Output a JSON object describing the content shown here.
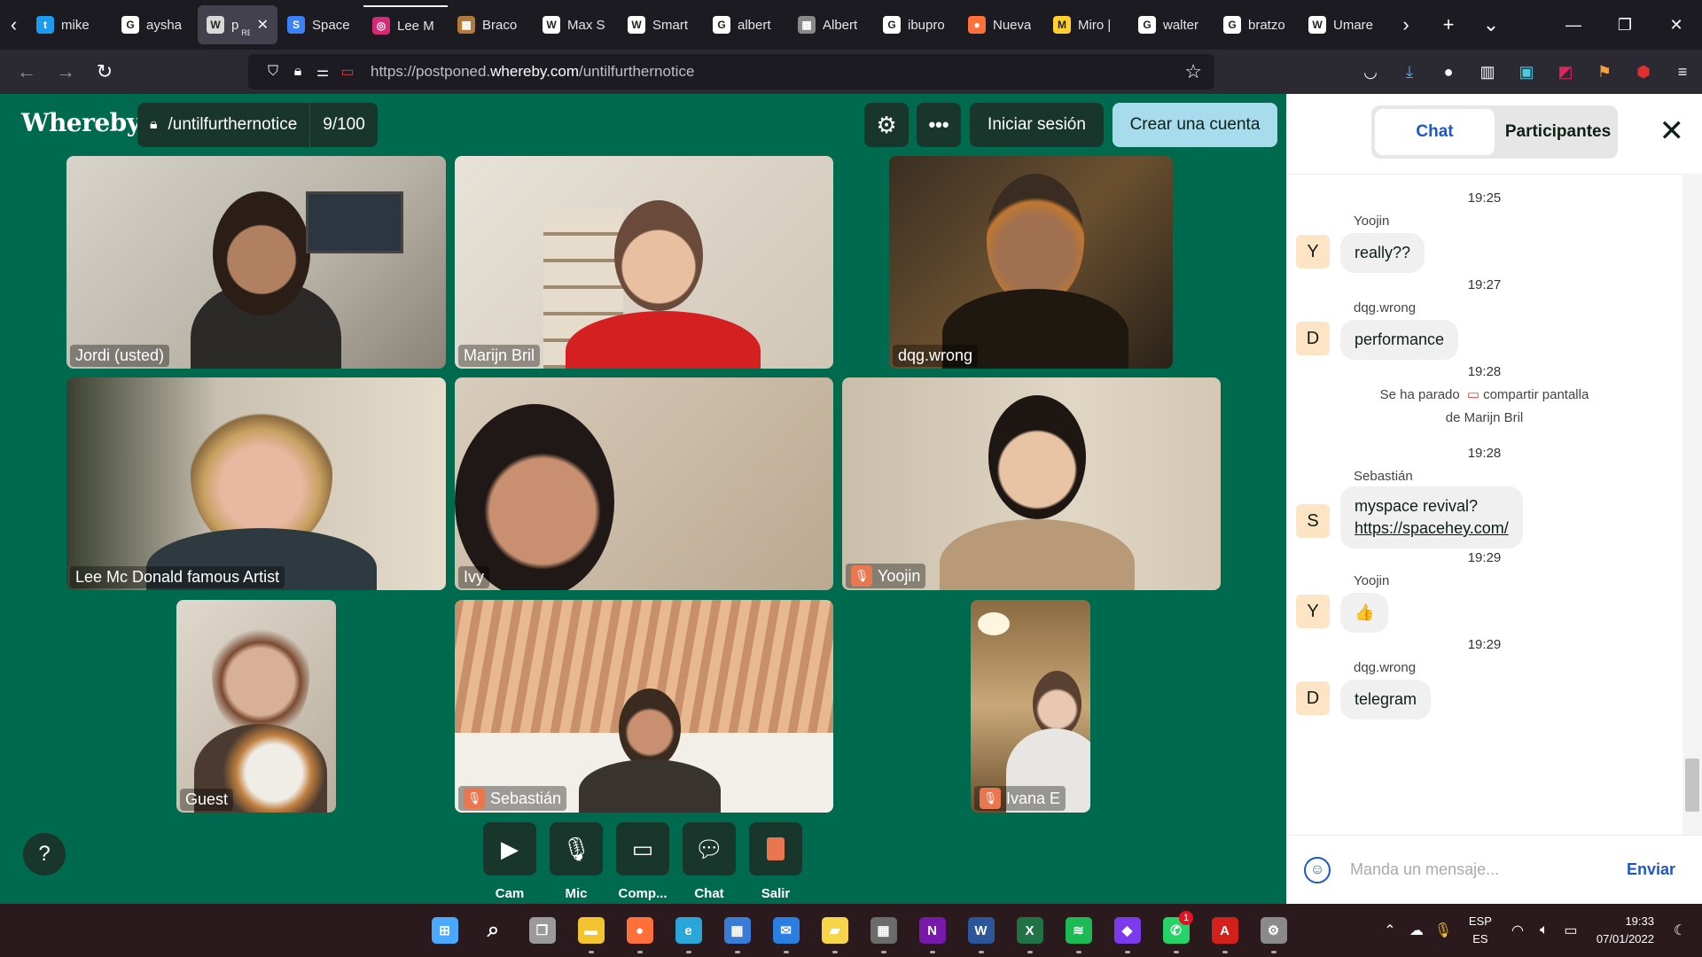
{
  "browser": {
    "tabs": [
      {
        "label": "mike",
        "favicon": "twitter-icon",
        "color": "#1d9bf0",
        "glyph": "t"
      },
      {
        "label": "aysha",
        "favicon": "google-icon",
        "color": "#ffffff",
        "glyph": "G"
      },
      {
        "label": "pos",
        "label2": "REPL",
        "favicon": "wikipedia-icon",
        "color": "#d8d8d8",
        "glyph": "W",
        "active": true
      },
      {
        "label": "Space",
        "favicon": "chat-icon",
        "color": "#3b82f6",
        "glyph": "S"
      },
      {
        "label": "Lee M",
        "favicon": "instagram-icon",
        "color": "#d62976",
        "glyph": "◎",
        "playing": true
      },
      {
        "label": "Braco",
        "favicon": "image-icon",
        "color": "#b07a3b",
        "glyph": "▦"
      },
      {
        "label": "Max S",
        "favicon": "wikipedia-icon",
        "color": "#ffffff",
        "glyph": "W"
      },
      {
        "label": "Smart",
        "favicon": "wikipedia-icon",
        "color": "#ffffff",
        "glyph": "W"
      },
      {
        "label": "albert",
        "favicon": "google-icon",
        "color": "#ffffff",
        "glyph": "G"
      },
      {
        "label": "Albert",
        "favicon": "image-icon",
        "color": "#888888",
        "glyph": "▦"
      },
      {
        "label": "ibupro",
        "favicon": "google-icon",
        "color": "#ffffff",
        "glyph": "G"
      },
      {
        "label": "Nueva",
        "favicon": "firefox-icon",
        "color": "#ff7139",
        "glyph": "●"
      },
      {
        "label": "Miro |",
        "favicon": "miro-icon",
        "color": "#ffd02f",
        "glyph": "M"
      },
      {
        "label": "walter",
        "favicon": "google-icon",
        "color": "#ffffff",
        "glyph": "G"
      },
      {
        "label": "bratzo",
        "favicon": "google-icon",
        "color": "#ffffff",
        "glyph": "G"
      },
      {
        "label": "Umare",
        "favicon": "wikipedia-icon",
        "color": "#ffffff",
        "glyph": "W"
      }
    ],
    "url_prefix": "https://postponed.",
    "url_domain": "whereby.com",
    "url_path": "/untilfurthernotice"
  },
  "app": {
    "logo": "Whereby",
    "room_name": "/untilfurthernotice",
    "participant_count": "9/100",
    "login_label": "Iniciar sesión",
    "signup_label": "Crear una cuenta",
    "help_label": "?",
    "accent": "#006a4e",
    "controls": [
      {
        "label": "Cam",
        "icon": "camera-icon"
      },
      {
        "label": "Mic",
        "icon": "microphone-icon"
      },
      {
        "label": "Comp...",
        "icon": "screen-share-icon"
      },
      {
        "label": "Chat",
        "icon": "chat-icon"
      },
      {
        "label": "Salir",
        "icon": "leave-icon"
      }
    ]
  },
  "participants": [
    {
      "name": "Jordi (usted)",
      "muted": false
    },
    {
      "name": "Marijn Bril",
      "muted": false
    },
    {
      "name": "dqg.wrong",
      "muted": false
    },
    {
      "name": "Lee Mc Donald famous Artist",
      "muted": false
    },
    {
      "name": "Ivy",
      "muted": false
    },
    {
      "name": "Yoojin",
      "muted": true
    },
    {
      "name": "Guest",
      "muted": false
    },
    {
      "name": "Sebastián",
      "muted": true
    },
    {
      "name": "Ivana E",
      "muted": true
    }
  ],
  "chat": {
    "tab_chat": "Chat",
    "tab_participants": "Participantes",
    "placeholder": "Manda un mensaje...",
    "send_label": "Enviar",
    "messages": [
      {
        "time": "19:25",
        "sender": "Yoojin",
        "initial": "Y",
        "text": "really??"
      },
      {
        "time": "19:27",
        "sender": "dqg.wrong",
        "initial": "D",
        "text": "performance"
      },
      {
        "time": "19:28",
        "system_before": "Se ha parado",
        "system_action": "compartir pantalla",
        "system_after": "de Marijn Bril"
      },
      {
        "time": "19:28",
        "sender": "Sebastián",
        "initial": "S",
        "text": "myspace revival?",
        "link": "https://spacehey.com/"
      },
      {
        "time": "19:29",
        "sender": "Yoojin",
        "initial": "Y",
        "text": "👍"
      },
      {
        "time": "19:29",
        "sender": "dqg.wrong",
        "initial": "D",
        "text": "telegram"
      }
    ]
  },
  "taskbar": {
    "apps": [
      {
        "name": "windows-start-icon",
        "color": "#4aa8ff",
        "glyph": "⊞"
      },
      {
        "name": "search-icon",
        "color": "transparent",
        "glyph": "⌕"
      },
      {
        "name": "task-view-icon",
        "color": "#9a9a9a",
        "glyph": "❐"
      },
      {
        "name": "file-explorer-icon",
        "color": "#f4c430",
        "glyph": "▬"
      },
      {
        "name": "firefox-icon",
        "color": "#ff7139",
        "glyph": "●"
      },
      {
        "name": "edge-icon",
        "color": "#2aa7d8",
        "glyph": "e"
      },
      {
        "name": "calendar-icon",
        "color": "#3a7bd5",
        "glyph": "▦"
      },
      {
        "name": "mail-icon",
        "color": "#2a7de1",
        "glyph": "✉"
      },
      {
        "name": "sticky-notes-icon",
        "color": "#f7d548",
        "glyph": "▰"
      },
      {
        "name": "calculator-icon",
        "color": "#6b6b6b",
        "glyph": "▦"
      },
      {
        "name": "onenote-icon",
        "color": "#7719aa",
        "glyph": "N"
      },
      {
        "name": "word-icon",
        "color": "#2b579a",
        "glyph": "W"
      },
      {
        "name": "excel-icon",
        "color": "#217346",
        "glyph": "X"
      },
      {
        "name": "spotify-icon",
        "color": "#1db954",
        "glyph": "≋"
      },
      {
        "name": "obsidian-icon",
        "color": "#7c3aed",
        "glyph": "◆"
      },
      {
        "name": "whatsapp-icon",
        "color": "#25d366",
        "glyph": "✆",
        "badge": "1"
      },
      {
        "name": "acrobat-icon",
        "color": "#d4201b",
        "glyph": "A"
      },
      {
        "name": "settings-icon",
        "color": "#8a8a8a",
        "glyph": "⚙"
      }
    ],
    "lang_top": "ESP",
    "lang_bottom": "ES",
    "time": "19:33",
    "date": "07/01/2022"
  }
}
